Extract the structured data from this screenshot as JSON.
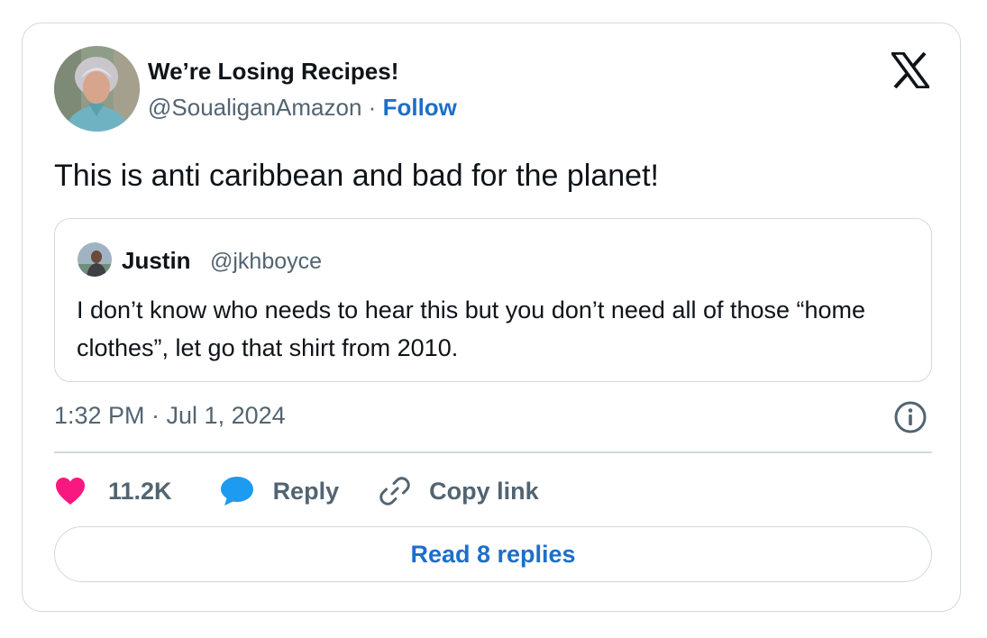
{
  "post": {
    "author_name": "We’re Losing Recipes!",
    "author_handle": "@SoualiganAmazon",
    "separator": "·",
    "follow_label": "Follow",
    "text": "This is anti caribbean and bad for the planet!",
    "timestamp": "1:32 PM · Jul 1, 2024"
  },
  "quoted": {
    "author_name": "Justin",
    "author_handle": "@jkhboyce",
    "text": "I don’t know who needs to hear this but you don’t need all of those “home clothes”, let go that shirt from 2010."
  },
  "actions": {
    "like_count": "11.2K",
    "reply_label": "Reply",
    "copy_label": "Copy link"
  },
  "read_replies_label": "Read 8 replies",
  "icons": {
    "brand": "x-logo-icon",
    "info": "info-icon",
    "like": "heart-icon",
    "reply": "speech-bubble-icon",
    "copy": "link-icon"
  },
  "colors": {
    "link": "#1d6fc9",
    "like": "#f91880",
    "reply": "#1d9bf0",
    "muted": "#536471",
    "text": "#0f1419",
    "border": "#cfd9de"
  }
}
